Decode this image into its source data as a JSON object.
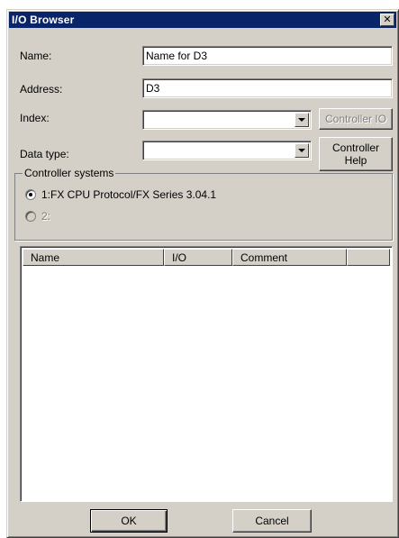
{
  "window": {
    "title": "I/O Browser"
  },
  "form": {
    "name_label": "Name:",
    "name_value": "Name for D3",
    "address_label": "Address:",
    "address_value": "D3",
    "index_label": "Index:",
    "index_value": "",
    "datatype_label": "Data type:",
    "datatype_value": "",
    "controller_io_button": "Controller IO",
    "controller_help_button_line1": "Controller",
    "controller_help_button_line2": "Help"
  },
  "controller_systems": {
    "legend": "Controller systems",
    "options": [
      {
        "label": "1:FX CPU Protocol/FX Series 3.04.1",
        "checked": true,
        "enabled": true
      },
      {
        "label": "2:",
        "checked": false,
        "enabled": false
      }
    ]
  },
  "table": {
    "columns": [
      "Name",
      "I/O",
      "Comment",
      ""
    ],
    "rows": []
  },
  "buttons": {
    "ok": "OK",
    "cancel": "Cancel"
  },
  "icons": {
    "close": "close-icon",
    "dropdown": "chevron-down-icon"
  },
  "colors": {
    "titlebar": "#0a246a",
    "face": "#d4d0c8"
  }
}
